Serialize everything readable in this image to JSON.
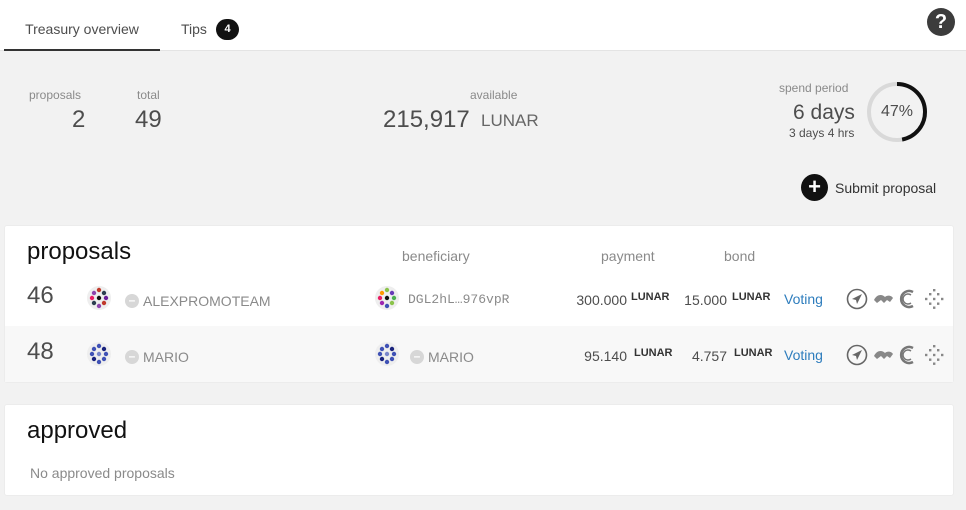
{
  "tabs": {
    "treasury": "Treasury overview",
    "tips": "Tips",
    "tips_count": "4"
  },
  "summary": {
    "proposals_label": "proposals",
    "proposals_value": "2",
    "total_label": "total",
    "total_value": "49",
    "available_label": "available",
    "available_value": "215,917",
    "available_unit": "LUNAR",
    "spend_label": "spend period",
    "spend_days": "6 days",
    "spend_remaining": "3 days 4 hrs",
    "spend_percent_text": "47%",
    "spend_fraction": 0.47
  },
  "submit_label": "Submit proposal",
  "proposals": {
    "title": "proposals",
    "col_beneficiary": "beneficiary",
    "col_payment": "payment",
    "col_bond": "bond",
    "rows": [
      {
        "id": "46",
        "proposer": "ALEXPROMOTEAM",
        "beneficiary": "DGL2hL…976vpR",
        "payment": "300.000",
        "payment_unit": "LUNAR",
        "bond": "15.000",
        "bond_unit": "LUNAR",
        "status": "Voting"
      },
      {
        "id": "48",
        "proposer": "MARIO",
        "beneficiary": "MARIO",
        "payment": "95.140",
        "payment_unit": "LUNAR",
        "bond": "4.757",
        "bond_unit": "LUNAR",
        "status": "Voting"
      }
    ]
  },
  "approved": {
    "title": "approved",
    "empty": "No approved proposals"
  },
  "colors": {
    "accent": "#2e7dbd",
    "badge": "#111111",
    "gauge_track": "#d9d9d9",
    "gauge_fill": "#111111"
  },
  "icons": [
    "help-icon",
    "plus-icon",
    "polkassembly-icon",
    "subsquare-icon",
    "commonwealth-icon",
    "polkaholic-icon"
  ]
}
